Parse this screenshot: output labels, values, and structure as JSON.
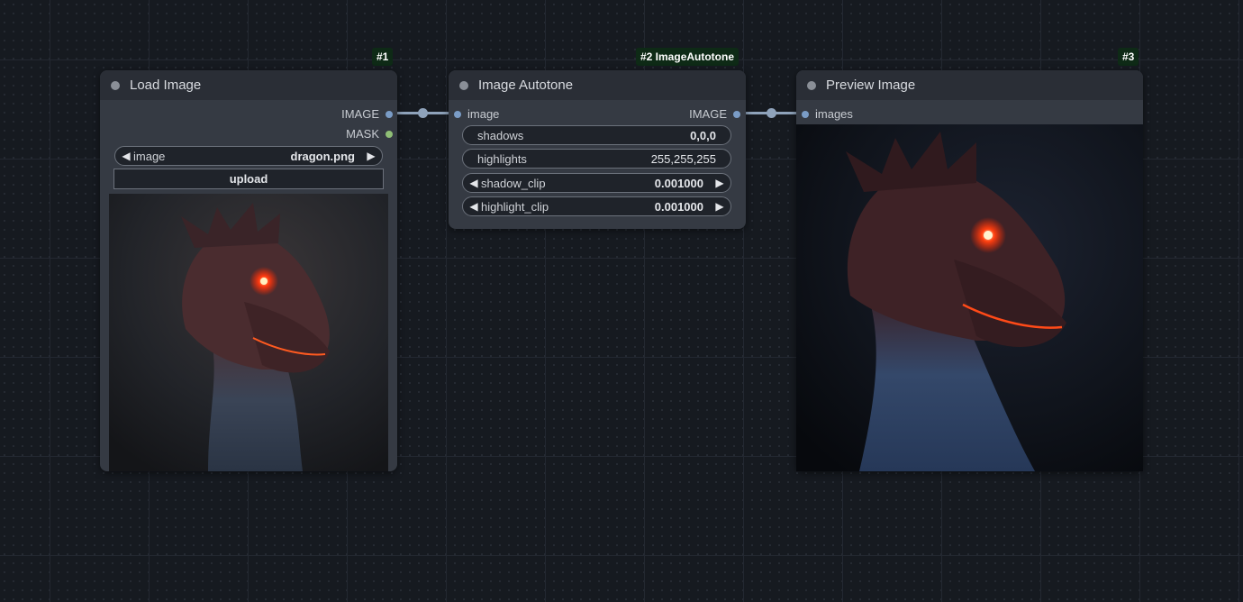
{
  "nodes": {
    "load": {
      "badge": "#1",
      "title": "Load Image",
      "outputs": [
        "IMAGE",
        "MASK"
      ],
      "image_widget": {
        "label": "image",
        "value": "dragon.png"
      },
      "upload_label": "upload"
    },
    "autotone": {
      "badge": "#2 ImageAutotone",
      "title": "Image Autotone",
      "input": "image",
      "output": "IMAGE",
      "widgets": {
        "shadows": {
          "label": "shadows",
          "value": "0,0,0"
        },
        "highlights": {
          "label": "highlights",
          "value": "255,255,255"
        },
        "shadow_clip": {
          "label": "shadow_clip",
          "value": "0.001000"
        },
        "highlight_clip": {
          "label": "highlight_clip",
          "value": "0.001000"
        }
      }
    },
    "preview": {
      "badge": "#3",
      "title": "Preview Image",
      "input": "images"
    }
  },
  "colors": {
    "image_slot": "#7a9cc6",
    "mask_slot": "#8fbf76",
    "link": "#8fa3bb",
    "badge_bg": "#0e2a16"
  },
  "icons": {
    "arrow_left": "◀",
    "arrow_right": "▶"
  }
}
